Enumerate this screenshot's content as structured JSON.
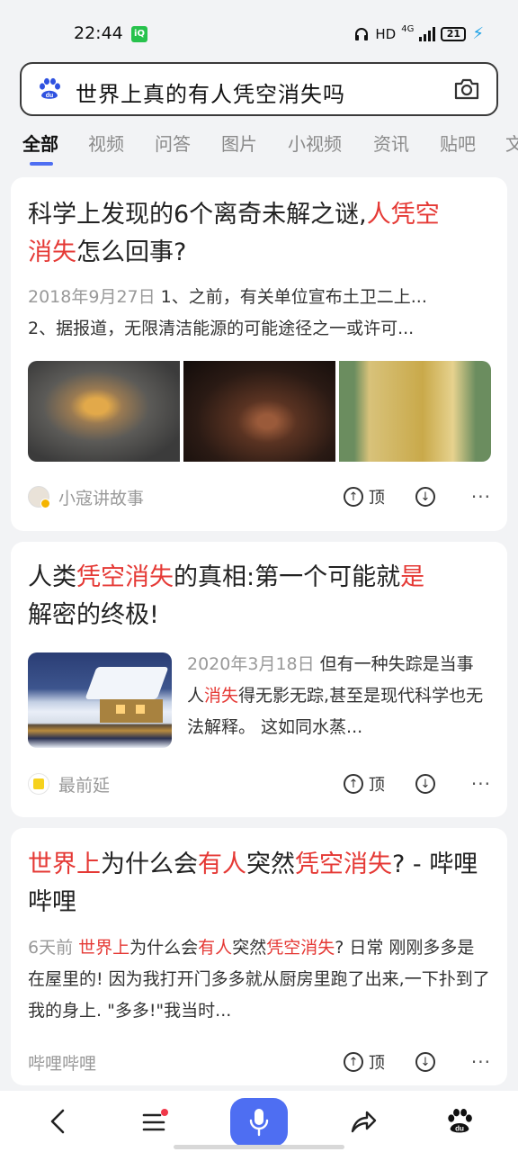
{
  "status_bar": {
    "time": "22:44",
    "left_icon": "iqiyi-icon",
    "hd": "HD",
    "network": "4G",
    "battery": "21",
    "charging_icon": "bolt-icon"
  },
  "search": {
    "query": "世界上真的有人凭空消失吗",
    "logo_icon": "baidu-paw-icon",
    "camera_icon": "camera-icon"
  },
  "tabs": [
    {
      "label": "全部",
      "active": true
    },
    {
      "label": "视频",
      "active": false
    },
    {
      "label": "问答",
      "active": false
    },
    {
      "label": "图片",
      "active": false
    },
    {
      "label": "小视频",
      "active": false
    },
    {
      "label": "资讯",
      "active": false
    },
    {
      "label": "贴吧",
      "active": false
    },
    {
      "label": "文",
      "active": false
    }
  ],
  "results": [
    {
      "title_parts": [
        "科学上发现的6个离奇未解之谜,",
        "人凭空",
        "消失",
        "怎么回事?"
      ],
      "date": "2018年9月27日",
      "summary_line1": "1、之前，有关单位宣布土卫二上...",
      "summary_line2": "2、据报道，无限清洁能源的可能途径之一或许可...",
      "source": "小寇讲故事",
      "up_label": "顶"
    },
    {
      "title_parts": [
        "人类",
        "凭空消失",
        "的真相:第一个可能就",
        "是",
        "解密的终极!"
      ],
      "date": "2020年3月18日",
      "summary_parts": [
        "但有一种失踪是当事人",
        "消失",
        "得无影无踪,甚至是现代科学也无法解释。 这如同水蒸..."
      ],
      "source": "最前延",
      "up_label": "顶"
    },
    {
      "title_parts": [
        "世界上",
        "为什么会",
        "有人",
        "突然",
        "凭空消失",
        "? - 哔哩哔哩"
      ],
      "date": "6天前",
      "summary_parts": [
        "世界上",
        "为什么会",
        "有人",
        "突然",
        "凭空消失",
        "? 日常 刚刚多多是在屋里的! 因为我打开门多多就从厨房里跑了出来,一下扑到了我的身上. \"多多!\"我当时..."
      ],
      "source": "哔哩哔哩",
      "up_label": "顶"
    }
  ],
  "bottom_nav": {
    "back_icon": "back-chevron-icon",
    "menu_icon": "menu-icon",
    "mic_icon": "microphone-icon",
    "share_icon": "share-icon",
    "home_icon": "baidu-paw-icon"
  },
  "colors": {
    "accent": "#4e6ef2",
    "highlight": "#e53935",
    "muted": "#999999"
  }
}
